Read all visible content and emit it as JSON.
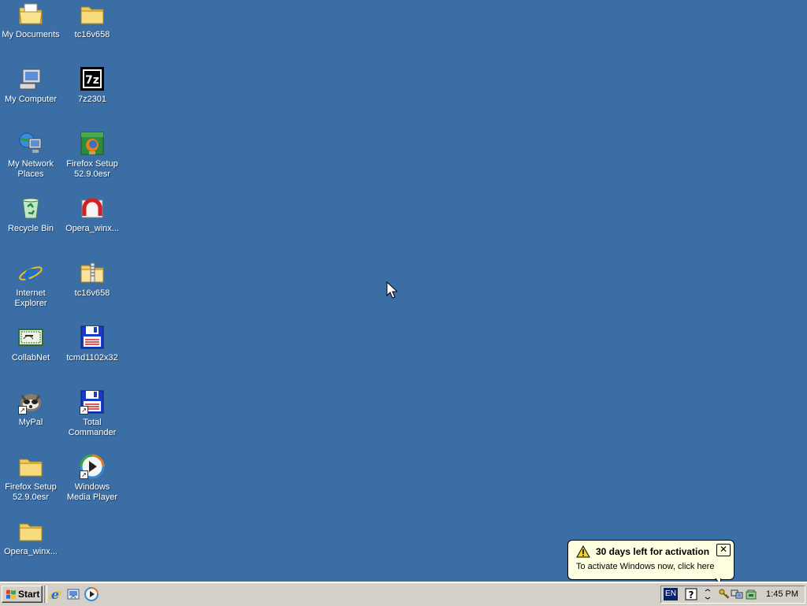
{
  "desktop": {
    "icons": [
      {
        "label": "My Documents",
        "icon": "my-documents-icon"
      },
      {
        "label": "tc16v658",
        "icon": "folder-icon"
      },
      {
        "label": "My Computer",
        "icon": "my-computer-icon"
      },
      {
        "label": "7z2301",
        "icon": "7zip-icon"
      },
      {
        "label": "My Network Places",
        "icon": "network-places-icon"
      },
      {
        "label": "Firefox Setup 52.9.0esr",
        "icon": "firefox-setup-icon"
      },
      {
        "label": "Recycle Bin",
        "icon": "recycle-bin-icon"
      },
      {
        "label": "Opera_winx...",
        "icon": "opera-installer-icon"
      },
      {
        "label": "Internet Explorer",
        "icon": "internet-explorer-icon"
      },
      {
        "label": "tc16v658",
        "icon": "zip-folder-icon"
      },
      {
        "label": "CollabNet",
        "icon": "collabnet-icon"
      },
      {
        "label": "tcmd1102x32",
        "icon": "floppy-installer-icon"
      },
      {
        "label": "MyPal",
        "icon": "mypal-icon"
      },
      {
        "label": "Total Commander",
        "icon": "total-commander-icon"
      },
      {
        "label": "Firefox Setup 52.9.0esr",
        "icon": "folder-icon"
      },
      {
        "label": "Windows Media Player",
        "icon": "media-player-icon"
      },
      {
        "label": "Opera_winx...",
        "icon": "folder-icon"
      }
    ]
  },
  "taskbar": {
    "start_label": "Start",
    "quick_launch": [
      "internet-explorer-icon",
      "show-desktop-icon",
      "media-player-icon"
    ],
    "tray": {
      "language": "EN",
      "clock": "1:45 PM"
    }
  },
  "balloon": {
    "title": "30 days left for activation",
    "body": "To activate Windows now, click here",
    "close_label": "✕"
  },
  "colors": {
    "desktop": "#3a6ea5",
    "taskbar": "#d4d0c8",
    "balloon": "#ffffe1"
  }
}
